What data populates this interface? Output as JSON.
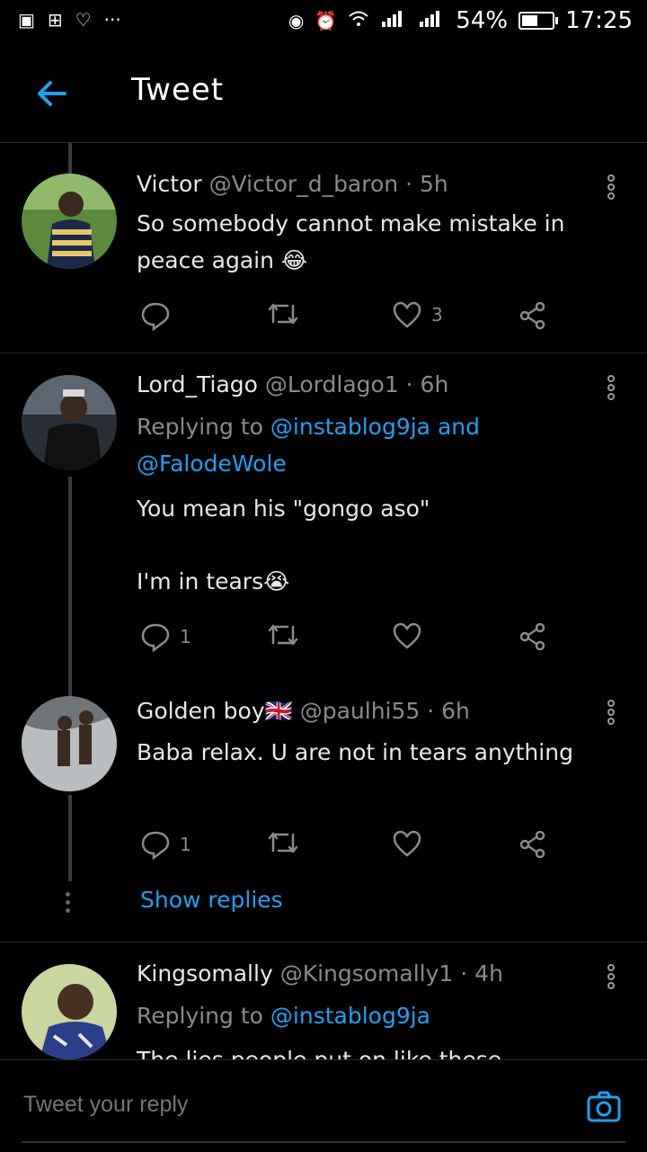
{
  "status_bar": {
    "battery": "54%",
    "time": "17:25",
    "battery_level": 0.54
  },
  "appbar": {
    "title": "Tweet"
  },
  "tweets": [
    {
      "name": "Victor",
      "handle": "@Victor_d_baron · 5h",
      "text": "So somebody cannot make mistake in peace again",
      "emoji": "😂",
      "like_count": "3",
      "reply_count": ""
    },
    {
      "name": "Lord_Tiago",
      "handle": "@Lordlago1 · 6h",
      "replying_prefix": "Replying to",
      "replying_targets": "@instablog9ja and",
      "replying_targets2": "@FalodeWole",
      "text": "You mean his \"gongo aso\"",
      "text2": "I'm in tears",
      "emoji": "😭",
      "reply_count": "1"
    },
    {
      "name": "Golden boy",
      "flag": "🇬🇧",
      "handle": "@paulhi55 · 6h",
      "text": "Baba relax. U are not in tears anything",
      "reply_count": "1"
    },
    {
      "name": "Kingsomally",
      "handle": "@Kingsomally1 · 4h",
      "replying_prefix": "Replying to",
      "replying_targets": "@instablog9ja",
      "text": "The lies people put on like these"
    }
  ],
  "show_replies": "Show replies",
  "composer": {
    "placeholder": "Tweet your reply"
  },
  "colors": {
    "background": "#000000",
    "accent": "#1da1f2",
    "muted": "#8a8a8a"
  }
}
